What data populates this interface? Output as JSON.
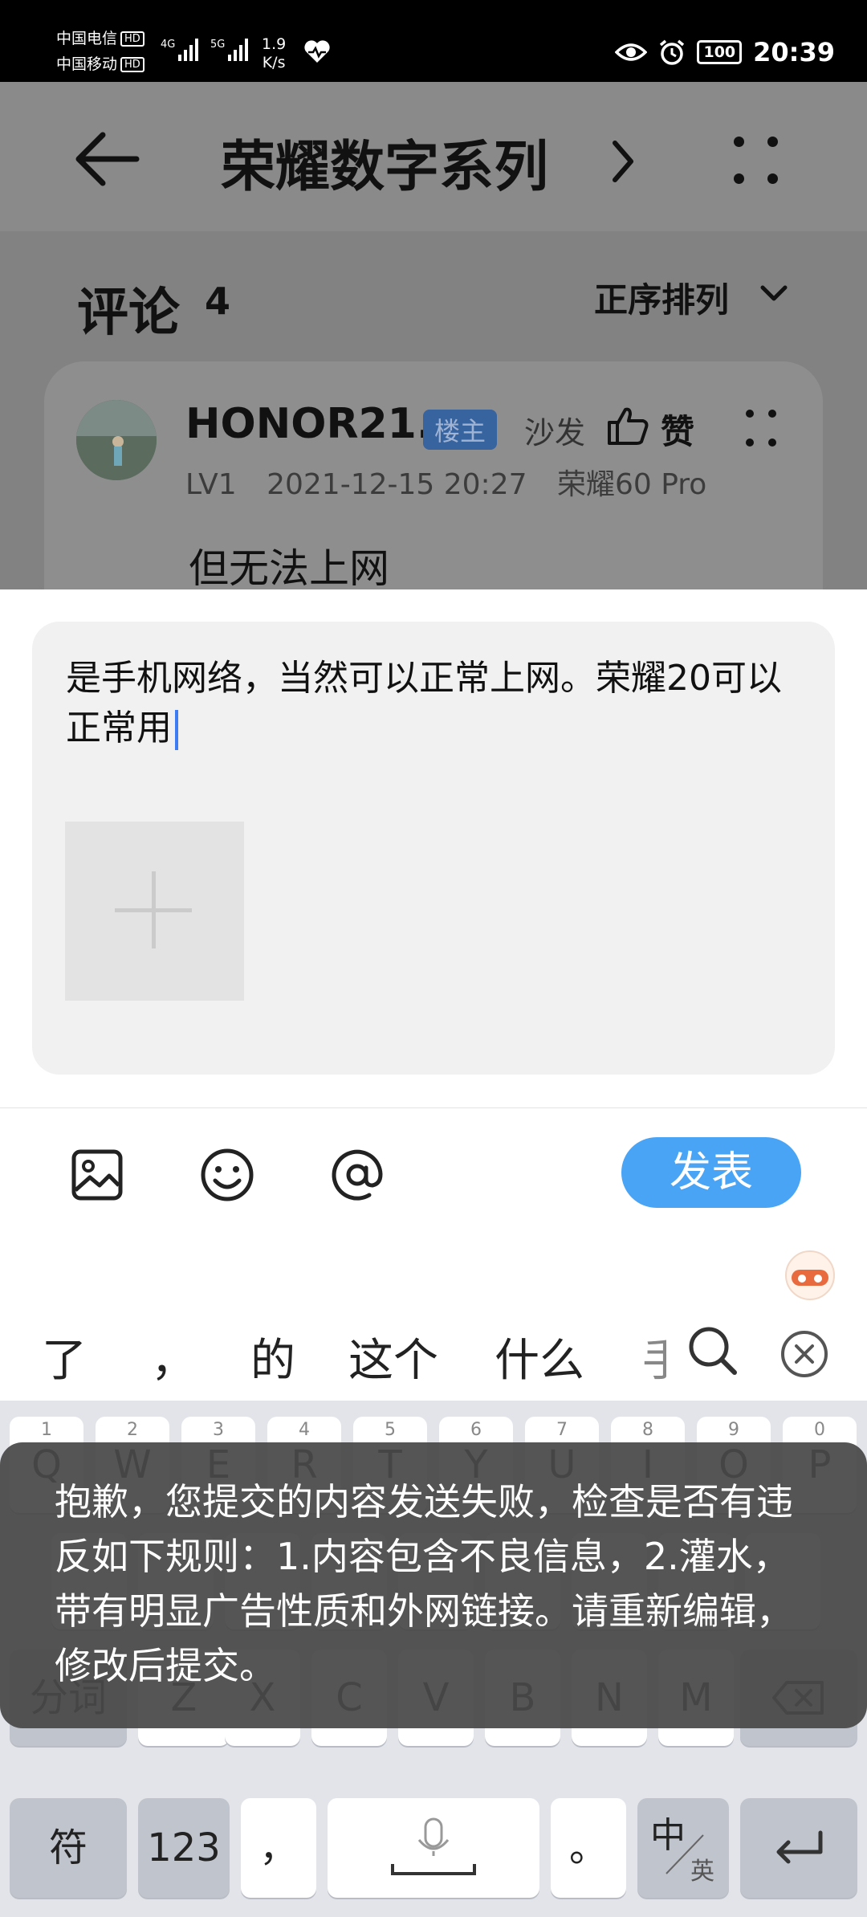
{
  "status_bar": {
    "carrier1": "中国电信",
    "carrier2": "中国移动",
    "hd": "HD",
    "net1": "4G",
    "net2": "5G",
    "speed_value": "1.9",
    "speed_unit": "K/s",
    "battery": "100",
    "time": "20:39"
  },
  "header": {
    "title": "荣耀数字系列"
  },
  "comments": {
    "label": "评论",
    "count": "4",
    "sort_label": "正序排列",
    "first": {
      "username": "HONOR21...",
      "badge": "楼主",
      "floor": "沙发",
      "like_label": "赞",
      "level": "LV1",
      "datetime": "2021-12-15 20:27",
      "device": "荣耀60 Pro",
      "text": "但无法上网"
    }
  },
  "compose": {
    "text": "是手机网络，当然可以正常上网。荣耀20可以正常用"
  },
  "toolbar": {
    "publish_label": "发表"
  },
  "suggestions": [
    "了",
    "，",
    "的",
    "这个",
    "什么",
    "手"
  ],
  "keyboard": {
    "row1_letters": [
      "Q",
      "W",
      "E",
      "R",
      "T",
      "Y",
      "U",
      "I",
      "O",
      "P"
    ],
    "row1_nums": [
      "1",
      "2",
      "3",
      "4",
      "5",
      "6",
      "7",
      "8",
      "9",
      "0"
    ],
    "row3_letters": [
      "Z",
      "X",
      "C",
      "V",
      "B",
      "N",
      "M"
    ],
    "fenci": "分词",
    "symbols": "符",
    "numbers": "123",
    "comma": "，",
    "period": "。",
    "lang_zh": "中",
    "lang_en": "英"
  },
  "toast": {
    "message": "抱歉，您提交的内容发送失败，检查是否有违反如下规则：1.内容包含不良信息，2.灌水，带有明显广告性质和外网链接。请重新编辑，修改后提交。"
  },
  "colors": {
    "accent": "#4aa4f5",
    "badge_bg": "#37639f",
    "toast_bg": "#484848"
  }
}
